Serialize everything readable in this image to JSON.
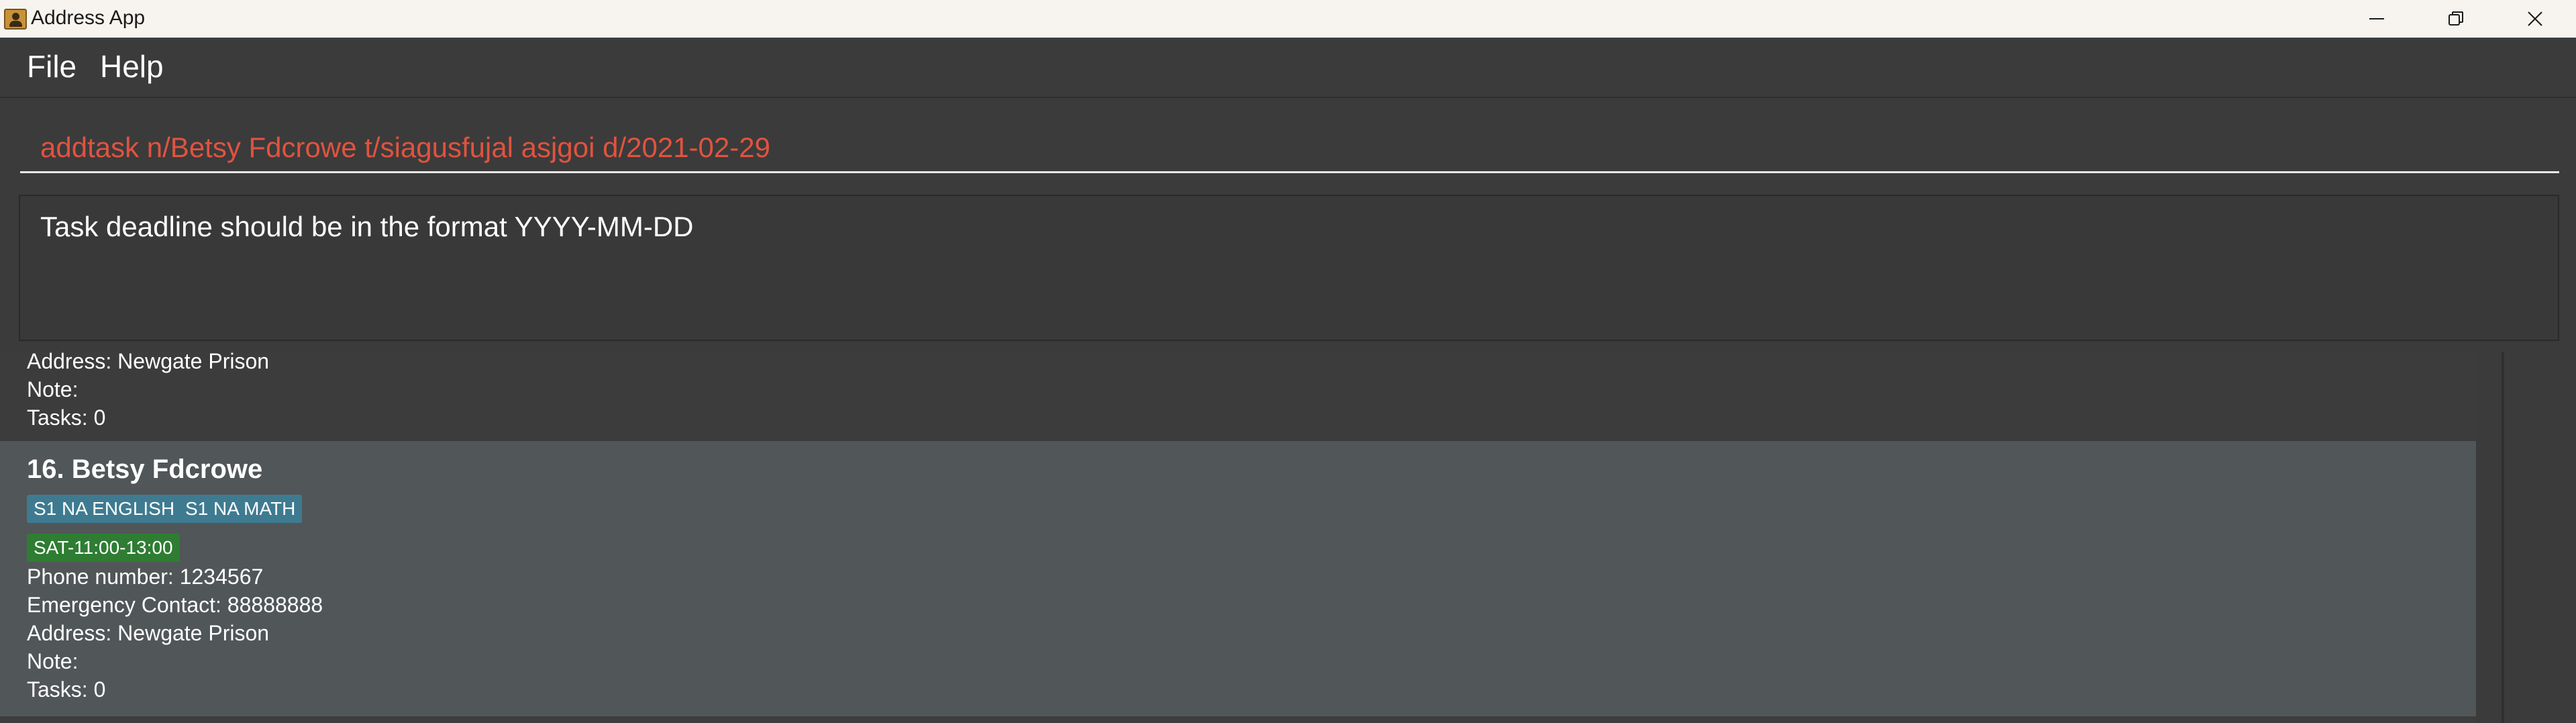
{
  "window": {
    "title": "Address App",
    "controls": {
      "minimize_icon": "minimize-icon",
      "restore_icon": "restore-icon",
      "close_icon": "close-icon"
    }
  },
  "menu": {
    "items": [
      {
        "label": "File"
      },
      {
        "label": "Help"
      }
    ]
  },
  "command": {
    "value": "addtask n/Betsy Fdcrowe t/siagusfujal asjgoi d/2021-02-29",
    "text_color": "#e1533f"
  },
  "result": {
    "message": "Task deadline should be in the format YYYY-MM-DD"
  },
  "person_list": {
    "previous_card": {
      "address": "Address: Newgate Prison",
      "note": "Note:",
      "tasks": "Tasks: 0"
    },
    "selected_card": {
      "index_name": "16. Betsy Fdcrowe",
      "subject_tags": [
        "S1 NA ENGLISH",
        "S1 NA MATH"
      ],
      "lesson_tags": [
        "SAT-11:00-13:00"
      ],
      "phone": "Phone number: 1234567",
      "emergency_contact": "Emergency Contact: 88888888",
      "address": "Address: Newgate Prison",
      "note": "Note:",
      "tasks": "Tasks: 0"
    },
    "colors": {
      "subject_tag": "#3e7b91",
      "lesson_tag": "#2e7d32",
      "selected_card_bg": "#515658"
    }
  }
}
